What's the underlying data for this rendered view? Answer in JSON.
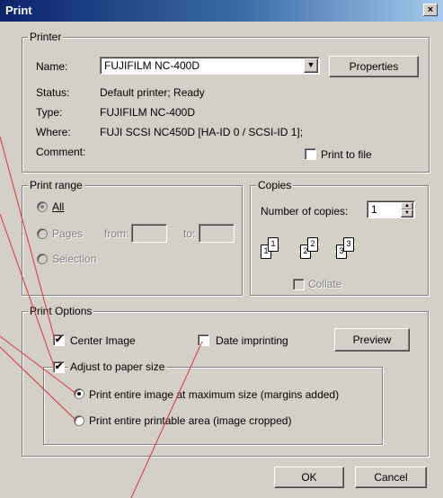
{
  "window": {
    "title": "Print",
    "close_label": "×"
  },
  "printer": {
    "legend": "Printer",
    "name_label": "Name:",
    "name_value": "FUJIFILM NC-400D",
    "properties_label": "Properties",
    "status_label": "Status:",
    "status_value": "Default printer; Ready",
    "type_label": "Type:",
    "type_value": "FUJIFILM NC-400D",
    "where_label": "Where:",
    "where_value": "FUJI SCSI NC450D [HA-ID 0 / SCSI-ID 1];",
    "comment_label": "Comment:",
    "print_to_file_label": "Print to file"
  },
  "print_range": {
    "legend": "Print range",
    "all_label": "All",
    "pages_label": "Pages",
    "from_label": "from:",
    "to_label": "to:",
    "selection_label": "Selection"
  },
  "copies": {
    "legend": "Copies",
    "number_label": "Number of copies:",
    "number_value": "1",
    "collate_label": "Collate",
    "page_icons": [
      "1",
      "1",
      "2",
      "2",
      "3",
      "3"
    ]
  },
  "print_options": {
    "legend": "Print Options",
    "center_image_label": "Center Image",
    "center_image_checked": true,
    "date_imprinting_label": "Date imprinting",
    "date_imprinting_checked": false,
    "preview_label": "Preview",
    "adjust_label": "Adjust to paper size",
    "adjust_checked": true,
    "option_max_label": "Print entire image at maximum size (margins added)",
    "option_crop_label": "Print entire printable area (image cropped)"
  },
  "buttons": {
    "ok": "OK",
    "cancel": "Cancel"
  },
  "check_mark": "✔",
  "colors": {
    "title_start": "#0a246a",
    "title_end": "#a6caf0",
    "face": "#d4d0c8",
    "annotation_line": "#e0303a"
  }
}
